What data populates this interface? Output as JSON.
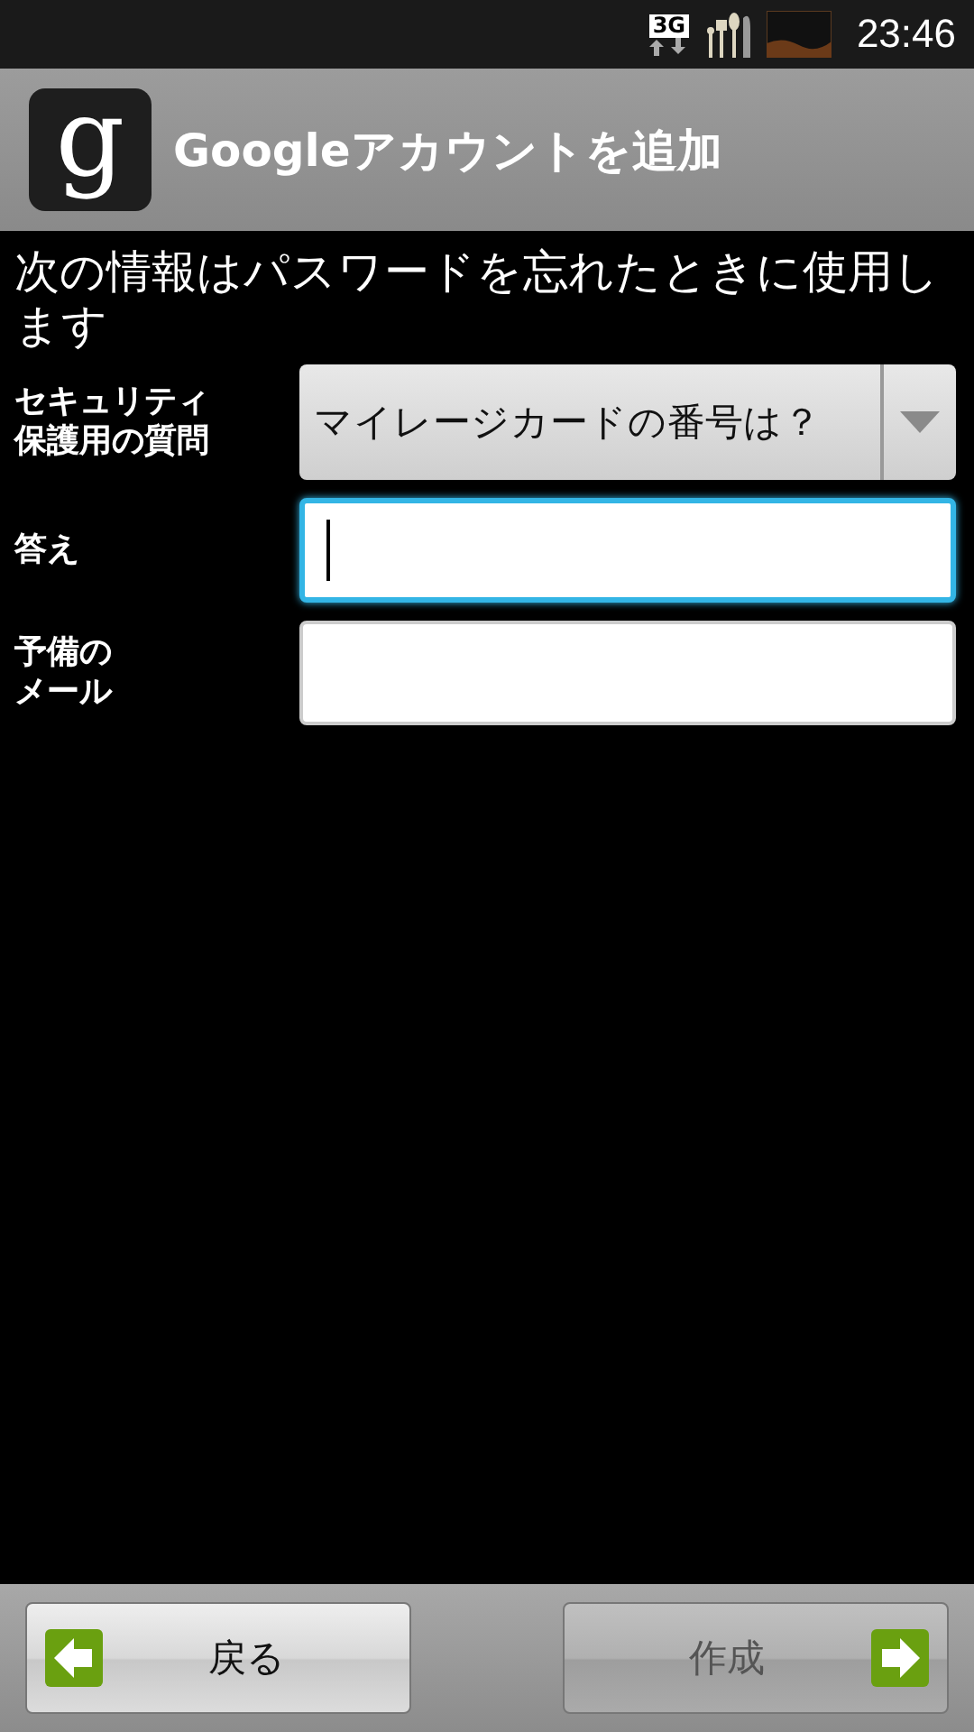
{
  "status_bar": {
    "network": "3G",
    "time": "23:46"
  },
  "title_bar": {
    "logo_glyph": "g",
    "title": "Googleアカウントを追加"
  },
  "intro": "次の情報はパスワードを忘れたときに使用します",
  "form": [
    {
      "kind": "dropdown",
      "label": "セキュリティ保護用の質問",
      "value": "マイレージカードの番号は？"
    },
    {
      "kind": "text",
      "label": "答え",
      "focused": true
    },
    {
      "kind": "text",
      "label": "予備のメール",
      "focused": false
    }
  ],
  "buttons": [
    {
      "kind": "back",
      "label": "戻る",
      "disabled": false
    },
    {
      "kind": "next",
      "label": "作成",
      "disabled": true
    }
  ]
}
